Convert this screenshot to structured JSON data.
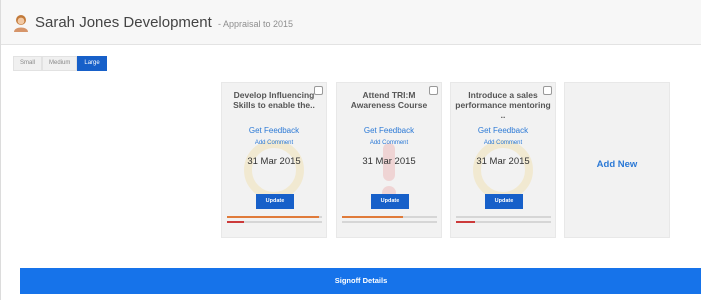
{
  "header": {
    "title": "Sarah Jones Development",
    "subtitle": "- Appraisal to 2015"
  },
  "size_options": [
    {
      "label": "Small",
      "active": false
    },
    {
      "label": "Medium",
      "active": false
    },
    {
      "label": "Large",
      "active": true
    }
  ],
  "cards": [
    {
      "title": "Develop Influencing Skills to enable the..",
      "feedback_link": "Get Feedback",
      "comment_link": "Add Comment",
      "date": "31 Mar 2015",
      "update_label": "Update",
      "progress": [
        0.97,
        0.18
      ],
      "progress_colors": [
        "#e07b3a",
        "#cc3a3a"
      ]
    },
    {
      "title": "Attend TRI:M Awareness Course",
      "feedback_link": "Get Feedback",
      "comment_link": "Add Comment",
      "date": "31 Mar 2015",
      "update_label": "Update",
      "progress": [
        0.64,
        0.0
      ],
      "progress_colors": [
        "#e07b3a",
        "#cc3a3a"
      ]
    },
    {
      "title": "Introduce a sales performance mentoring ..",
      "feedback_link": "Get Feedback",
      "comment_link": "Add Comment",
      "date": "31 Mar 2015",
      "update_label": "Update",
      "progress": [
        0.0,
        0.2
      ],
      "progress_colors": [
        "#e07b3a",
        "#cc3a3a"
      ]
    }
  ],
  "add_new_label": "Add New",
  "signoff_label": "Signoff Details",
  "colors": {
    "accent": "#1760c9",
    "link": "#2b79d6",
    "signoff": "#1673ea"
  },
  "icons": [
    "avatar-icon",
    "checkbox-icon",
    "watermark-icon"
  ]
}
